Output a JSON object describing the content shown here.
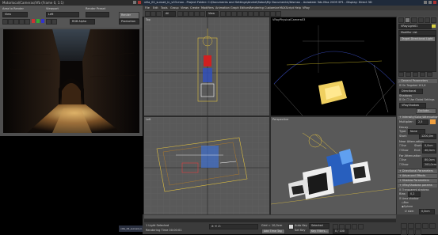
{
  "render_frame": {
    "title": "Motorlocal/Cameras/Vfb (Frame 0, 1:1)",
    "area_label": "Area to Render",
    "area_value": "View",
    "viewport_label": "Viewport",
    "viewport_value": "Left",
    "preset_label": "Render Preset",
    "preset_value": "",
    "render_button": "Render",
    "production_value": "Production",
    "rgb_alpha": "RGB Alpha"
  },
  "main_window": {
    "title": "villa_02_sunset_in_v03.max - Project Folder: C:\\Documents and Settings\\Andrei\\Sobol\\My Documents\\3dsmax - Autodesk 3ds Max 2009 SP1 - Display: Direct 3D",
    "menu": [
      "File",
      "Edit",
      "Tools",
      "Group",
      "Views",
      "Create",
      "Modifiers",
      "Animation",
      "Graph Editors",
      "Rendering",
      "Customize",
      "MAXScript",
      "Help",
      "VRay"
    ],
    "toolbar_all": "All",
    "toolbar_view": "View"
  },
  "viewports": {
    "top": "Top",
    "camera": "VRayPhysicalCamera03",
    "left": "Left",
    "perspective": "Perspective"
  },
  "command_panel": {
    "object_name": "VRayLight01",
    "modifier_list": "Modifier List",
    "stack_item": "Target Directional Light",
    "rollouts": [
      "+ Intensity/Color/Attenuation",
      "+ Directional Parameters",
      "+ Advanced Effects",
      "+ Shadow Parameters",
      "+ VRayShadows params"
    ],
    "general_header": "- General Parameters",
    "on_label": "On",
    "targeted_label": "Targeted",
    "target_dist": "101,6",
    "light_type": "Directional",
    "shadows_header": "Shadows",
    "shadows_on": "On",
    "use_global": "Use Global Settings",
    "shadow_type": "VRayShadow",
    "exclude_btn": "Exclude...",
    "multiplier_label": "Multiplier:",
    "multiplier_value": "2,5",
    "decay_header": "Decay",
    "decay_type_label": "Type:",
    "decay_type": "None",
    "start_label": "Start:",
    "start_value": "1200,0m",
    "near_atten": "Near Attenuation",
    "far_atten": "Far Attenuation",
    "use_label": "Use",
    "show_label": "Show",
    "start2": "Start:",
    "end2": "End:",
    "na_start": "0,0cm",
    "na_end": "40,0cm",
    "fa_start": "80,0cm",
    "fa_end": "200,0cm",
    "vrs_transparent": "Transparent shadows",
    "vrs_bias_label": "Bias:",
    "vrs_bias": "0,2",
    "vrs_area": "Area shadow",
    "vrs_box": "Box",
    "vrs_sphere": "Sphere",
    "u_size_label": "U size:",
    "u_size": "0,0cm",
    "v_size_label": "V size:",
    "v_size": "0,0cm",
    "w_size_label": "W size:",
    "w_size": "0,0cm",
    "subdivs_label": "Subdivs:",
    "subdivs": "8"
  },
  "status": {
    "selected": "1 Light Selected",
    "rendering": "Rendering Time 00:00:01",
    "coords": "X:  Y:  Z:",
    "grid": "Grid = 10,0cm",
    "add_time_tag": "Add Time Tag",
    "auto_key": "Auto Key",
    "set_key": "Set Key",
    "selected_dd": "Selected",
    "key_filters": "Key Filters...",
    "frame_counter": "0 / 100"
  },
  "taskbar": {
    "item": "villa_02_sunset_in..."
  }
}
